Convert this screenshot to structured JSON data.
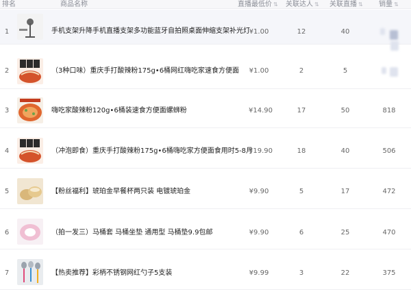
{
  "header": {
    "rank": "排名",
    "product": "商品名称",
    "price": "直播最低价",
    "talent": "关联达人",
    "live": "关联直播",
    "sales": "销量"
  },
  "sort_glyph": "⇅",
  "rows": [
    {
      "rank": "1",
      "title": "手机支架升降手机直播支架多功能蓝牙自拍照桌面伸缩支架补光灯",
      "price": "¥1.00",
      "talent": "12",
      "live": "40",
      "sales": "",
      "thumb": "stand-photo"
    },
    {
      "rank": "2",
      "title": "（3种口味）重庆手打酸辣粉175g•6桶网红嗨吃家速食方便面",
      "price": "¥1.00",
      "talent": "2",
      "live": "5",
      "sales": "",
      "thumb": "noodle-bucket-photo"
    },
    {
      "rank": "3",
      "title": "嗨吃家酸辣粉120g•6桶装速食方便面螺蛳粉",
      "price": "¥14.90",
      "talent": "17",
      "live": "50",
      "sales": "818",
      "thumb": "noodle-bowl-photo"
    },
    {
      "rank": "4",
      "title": "（冲泡即食）重庆手打酸辣粉175g•6桶嗨吃家方便面食用时5-8月",
      "price": "¥19.90",
      "talent": "18",
      "live": "40",
      "sales": "506",
      "thumb": "noodle-bucket-photo"
    },
    {
      "rank": "5",
      "title": "【粉丝福利】琥珀金早餐杯两只装 电镀琥珀金",
      "price": "¥9.90",
      "talent": "5",
      "live": "17",
      "sales": "472",
      "thumb": "cup-photo"
    },
    {
      "rank": "6",
      "title": "（拍一发三）马桶套 马桶坐垫 通用型 马桶垫9.9包邮",
      "price": "¥9.90",
      "talent": "6",
      "live": "25",
      "sales": "470",
      "thumb": "toilet-cover-photo"
    },
    {
      "rank": "7",
      "title": "【热卖推荐】彩柄不锈钢网红勺子5支装",
      "price": "¥9.99",
      "talent": "3",
      "live": "22",
      "sales": "375",
      "thumb": "spoon-photo"
    }
  ]
}
